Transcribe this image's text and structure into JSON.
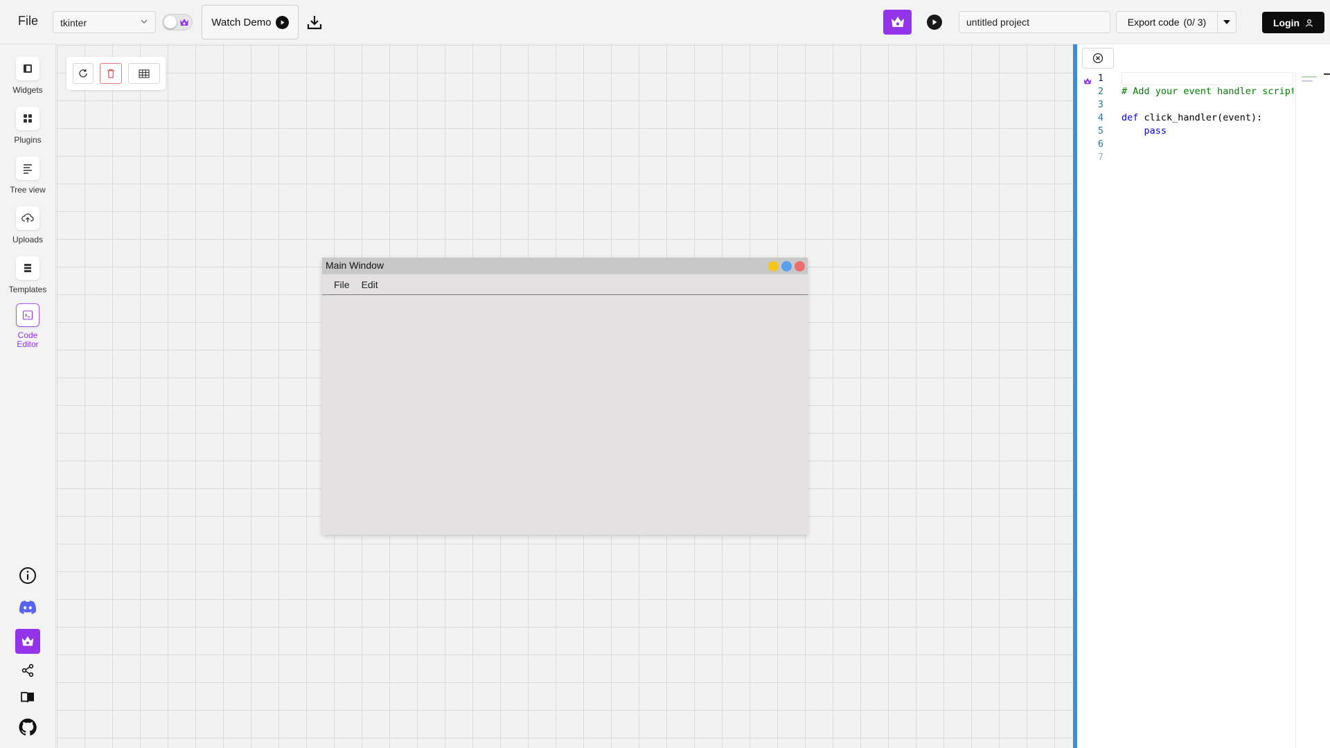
{
  "topbar": {
    "file_menu": "File",
    "framework": "tkinter",
    "watch_demo": "Watch Demo",
    "project_name": "untitled project",
    "export_label": "Export code",
    "export_count": "(0/ 3)",
    "login": "Login"
  },
  "sidebar": {
    "items": [
      {
        "label": "Widgets",
        "icon": "widgets-icon"
      },
      {
        "label": "Plugins",
        "icon": "plugins-icon"
      },
      {
        "label": "Tree view",
        "icon": "tree-view-icon"
      },
      {
        "label": "Uploads",
        "icon": "upload-icon"
      },
      {
        "label": "Templates",
        "icon": "templates-icon"
      },
      {
        "label": "Code Editor",
        "icon": "code-editor-icon",
        "active": true
      }
    ],
    "bottom_icons": [
      "info-icon",
      "discord-icon",
      "premium-crown-icon",
      "share-icon",
      "docs-book-icon",
      "github-icon"
    ]
  },
  "canvas": {
    "toolbar_icons": [
      "refresh-icon",
      "trash-icon",
      "grid-icon"
    ],
    "main_window": {
      "title": "Main Window",
      "menus": [
        "File",
        "Edit"
      ]
    }
  },
  "code_editor": {
    "lines": [
      {
        "n": "1",
        "text": ""
      },
      {
        "n": "2",
        "text": "# Add your event handler script"
      },
      {
        "n": "3",
        "text": ""
      },
      {
        "n": "4",
        "text": "def click_handler(event):"
      },
      {
        "n": "5",
        "text": "    pass"
      },
      {
        "n": "6",
        "text": ""
      },
      {
        "n": "7",
        "text": ""
      }
    ]
  },
  "colors": {
    "accent_purple": "#9333ea",
    "panel_border_blue": "#3a8fd6",
    "dot_yellow": "#f5c518",
    "dot_blue": "#5aa0f0",
    "dot_red": "#f06b6b"
  }
}
